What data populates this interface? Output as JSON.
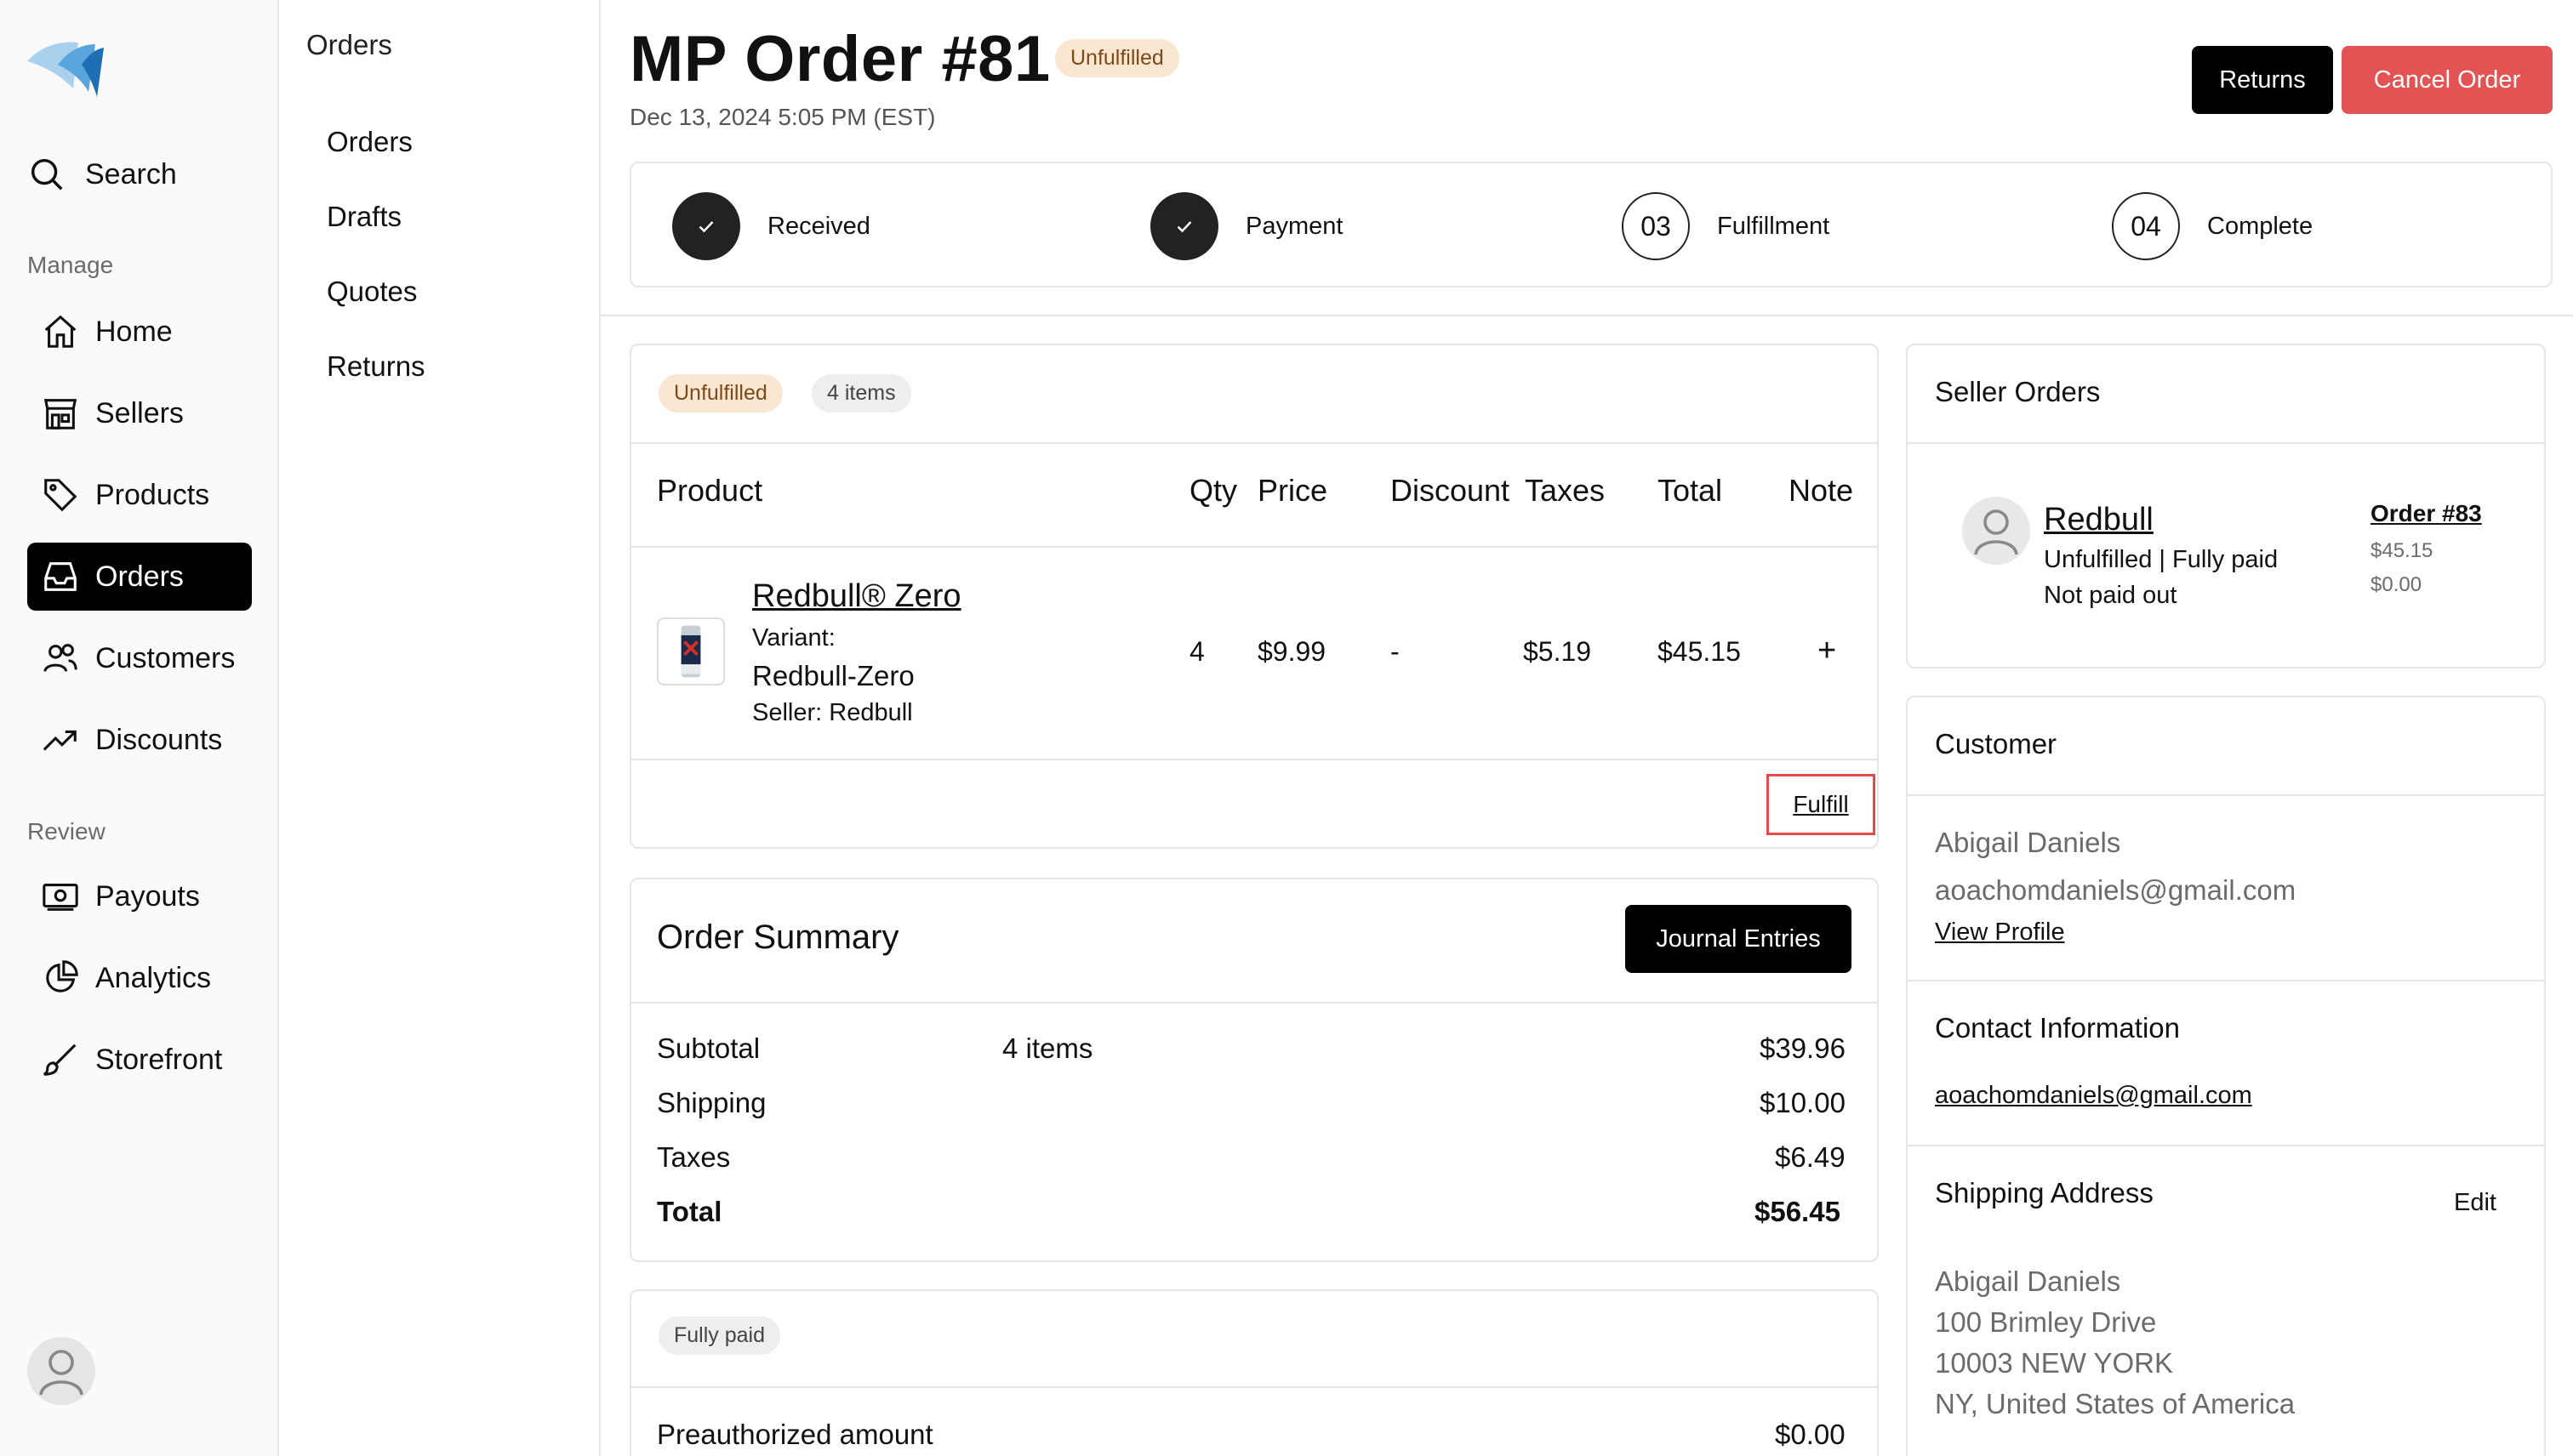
{
  "sidebar": {
    "search_label": "Search",
    "manage_label": "Manage",
    "review_label": "Review",
    "items": [
      {
        "label": "Home",
        "icon": "home-icon"
      },
      {
        "label": "Sellers",
        "icon": "store-icon"
      },
      {
        "label": "Products",
        "icon": "tag-icon"
      },
      {
        "label": "Orders",
        "icon": "inbox-icon",
        "active": true
      },
      {
        "label": "Customers",
        "icon": "users-icon"
      },
      {
        "label": "Discounts",
        "icon": "trending-icon"
      }
    ],
    "review_items": [
      {
        "label": "Payouts",
        "icon": "banknote-icon"
      },
      {
        "label": "Analytics",
        "icon": "pie-chart-icon"
      },
      {
        "label": "Storefront",
        "icon": "brush-icon"
      }
    ]
  },
  "subnav": {
    "title": "Orders",
    "items": [
      "Orders",
      "Drafts",
      "Quotes",
      "Returns"
    ]
  },
  "header": {
    "title": "MP Order #81",
    "status_badge": "Unfulfilled",
    "date": "Dec 13, 2024 5:05 PM (EST)",
    "returns_label": "Returns",
    "cancel_label": "Cancel Order"
  },
  "steps": [
    {
      "label": "Received",
      "state": "done"
    },
    {
      "label": "Payment",
      "state": "done"
    },
    {
      "label": "Fulfillment",
      "number": "03",
      "state": "open"
    },
    {
      "label": "Complete",
      "number": "04",
      "state": "open"
    }
  ],
  "items_card": {
    "status_badge": "Unfulfilled",
    "count_badge": "4 items",
    "columns": [
      "Product",
      "Qty",
      "Price",
      "Discount",
      "Taxes",
      "Total",
      "Note"
    ],
    "row": {
      "name": "Redbull® Zero",
      "variant_label": "Variant:",
      "variant": "Redbull-Zero",
      "seller": "Seller: Redbull",
      "qty": "4",
      "price": "$9.99",
      "discount": "-",
      "taxes": "$5.19",
      "total": "$45.15",
      "note_icon": "+"
    },
    "fulfill_label": "Fulfill"
  },
  "summary": {
    "title": "Order Summary",
    "journal_label": "Journal Entries",
    "rows": [
      {
        "label": "Subtotal",
        "detail": "4 items",
        "value": "$39.96"
      },
      {
        "label": "Shipping",
        "detail": "",
        "value": "$10.00"
      },
      {
        "label": "Taxes",
        "detail": "",
        "value": "$6.49"
      },
      {
        "label": "Total",
        "detail": "",
        "value": "$56.45"
      }
    ]
  },
  "payment": {
    "badge": "Fully paid",
    "preauth_label": "Preauthorized amount",
    "preauth_value": "$0.00"
  },
  "seller_orders": {
    "title": "Seller Orders",
    "seller_name": "Redbull",
    "status": "Unfulfilled | Fully paid",
    "payout": "Not paid out",
    "order_link": "Order #83",
    "amount1": "$45.15",
    "amount2": "$0.00"
  },
  "customer": {
    "title": "Customer",
    "name": "Abigail Daniels",
    "email": "aoachomdaniels@gmail.com",
    "view_profile": "View Profile",
    "contact_title": "Contact Information",
    "contact_email": "aoachomdaniels@gmail.com",
    "shipping_title": "Shipping Address",
    "edit_label": "Edit",
    "address": [
      "Abigail Daniels",
      "100 Brimley Drive",
      "10003 NEW YORK",
      "NY, United States of America"
    ]
  }
}
